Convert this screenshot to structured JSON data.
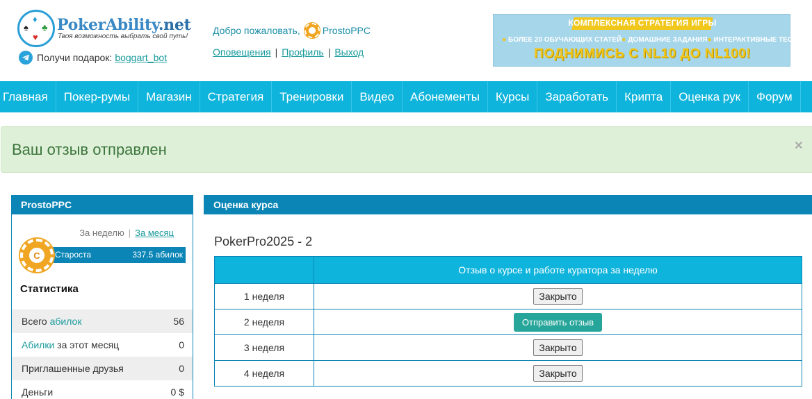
{
  "header": {
    "logo_main": "PokerAbility",
    "logo_tld": ".net",
    "logo_tagline": "Твоя возможность выбрать свой путь!",
    "gift_label": "Получи подарок:",
    "gift_link": "boggart_bot",
    "welcome_label": "Добро пожаловать,",
    "username": "ProstoPPC",
    "links": [
      "Оповещения",
      "Профиль",
      "Выход"
    ]
  },
  "banner": {
    "top": "КОМПЛЕКСНАЯ СТРАТЕГИЯ ИГРЫ",
    "features": [
      "БОЛЕЕ 20 ОБУЧАЮЩИХ СТАТЕЙ",
      "ДОМАШНИЕ ЗАДАНИЯ",
      "ИНТЕРАКТИВНЫЕ ТЕСТЫ"
    ],
    "headline": "ПОДНИМИСЬ С NL10 ДО NL100!"
  },
  "nav": [
    "Главная",
    "Покер-румы",
    "Магазин",
    "Стратегия",
    "Тренировки",
    "Видео",
    "Абонементы",
    "Курсы",
    "Заработать",
    "Крипта",
    "Оценка рук",
    "Форум"
  ],
  "alert": {
    "text": "Ваш отзыв отправлен",
    "close": "×"
  },
  "profile": {
    "title": "ProstoPPC",
    "period_week": "За неделю",
    "period_separator": "|",
    "period_month": "За месяц",
    "rank_letter": "C",
    "rank_name": "Староста",
    "rank_value": "337.5 абилок",
    "stats_title": "Статистика",
    "stats": [
      {
        "label_pre": "Всего ",
        "label_hl": "абилок",
        "label_post": "",
        "value": "56"
      },
      {
        "label_pre": "",
        "label_hl": "Абилки",
        "label_post": " за этот месяц",
        "value": "0"
      },
      {
        "label_pre": "Приглашенные друзья",
        "label_hl": "",
        "label_post": "",
        "value": "0"
      },
      {
        "label_pre": "Деньги",
        "label_hl": "",
        "label_post": "",
        "value": "0 $"
      }
    ]
  },
  "review": {
    "panel_title": "Оценка курса",
    "course": "PokerPro2025 - 2",
    "table_header": [
      "",
      "Отзыв о курсе и работе куратора за неделю"
    ],
    "rows": [
      {
        "week": "1 неделя",
        "action": "Закрыто",
        "kind": "closed"
      },
      {
        "week": "2 неделя",
        "action": "Отправить отзыв",
        "kind": "send"
      },
      {
        "week": "3 неделя",
        "action": "Закрыто",
        "kind": "closed"
      },
      {
        "week": "4 неделя",
        "action": "Закрыто",
        "kind": "closed"
      }
    ]
  },
  "colors": {
    "nav": "#0fb4dc",
    "panel_head": "#0a85b6",
    "success_bg": "#dff0d8",
    "success_text": "#3c763d",
    "send_button": "#26a69a",
    "chip": "#f0a623"
  }
}
